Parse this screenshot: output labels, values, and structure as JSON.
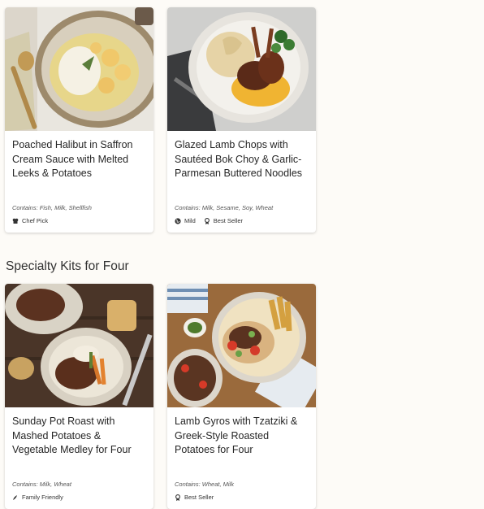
{
  "section_title": "Specialty Kits for Four",
  "cards": [
    {
      "title": "Poached Halibut in Saffron Cream Sauce with Melted Leeks & Potatoes",
      "contains": "Contains: Fish, Milk, Shellfish",
      "tags": [
        {
          "icon": "chef-hat-icon",
          "label": "Chef Pick"
        }
      ]
    },
    {
      "title": "Glazed Lamb Chops with Sautéed Bok Choy & Garlic-Parmesan Buttered Noodles",
      "contains": "Contains: Milk, Sesame, Soy, Wheat",
      "tags": [
        {
          "icon": "globe-icon",
          "label": "Mild"
        },
        {
          "icon": "ribbon-icon",
          "label": "Best Seller"
        }
      ]
    },
    {
      "title": "Sunday Pot Roast with Mashed Potatoes & Vegetable Medley for Four",
      "contains": "Contains: Milk, Wheat",
      "tags": [
        {
          "icon": "family-icon",
          "label": "Family Friendly"
        }
      ]
    },
    {
      "title": "Lamb Gyros with Tzatziki & Greek-Style Roasted Potatoes for Four",
      "contains": "Contains: Wheat, Milk",
      "tags": [
        {
          "icon": "ribbon-icon",
          "label": "Best Seller"
        }
      ]
    }
  ]
}
